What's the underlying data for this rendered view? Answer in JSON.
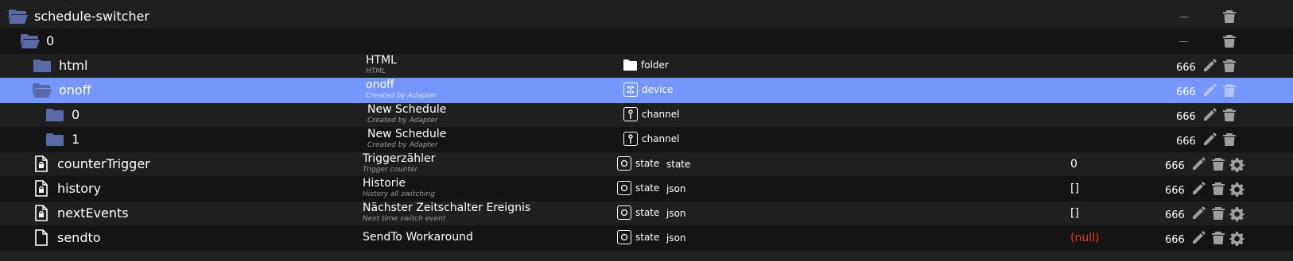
{
  "rows": [
    {
      "name": "schedule-switcher",
      "title": "",
      "desc": "",
      "type": "",
      "role": "",
      "value": "",
      "acl": "—"
    },
    {
      "name": "0",
      "title": "",
      "desc": "",
      "type": "",
      "role": "",
      "value": "",
      "acl": "—"
    },
    {
      "name": "html",
      "title": "HTML",
      "desc": "HTML",
      "type": "folder",
      "role": "",
      "value": "",
      "acl": "666"
    },
    {
      "name": "onoff",
      "title": "onoff",
      "desc": "Created by Adapter",
      "type": "device",
      "role": "",
      "value": "",
      "acl": "666"
    },
    {
      "name": "0",
      "title": "New Schedule",
      "desc": "Created by Adapter",
      "type": "channel",
      "role": "",
      "value": "",
      "acl": "666"
    },
    {
      "name": "1",
      "title": "New Schedule",
      "desc": "Created by Adapter",
      "type": "channel",
      "role": "",
      "value": "",
      "acl": "666"
    },
    {
      "name": "counterTrigger",
      "title": "Triggerzähler",
      "desc": "Trigger counter",
      "type": "state",
      "role": "state",
      "value": "0",
      "acl": "666"
    },
    {
      "name": "history",
      "title": "Historie",
      "desc": "History all switching",
      "type": "state",
      "role": "json",
      "value": "[]",
      "acl": "666"
    },
    {
      "name": "nextEvents",
      "title": "Nächster Zeitschalter Ereignis",
      "desc": "Next time switch event",
      "type": "state",
      "role": "json",
      "value": "[]",
      "acl": "666"
    },
    {
      "name": "sendto",
      "title": "SendTo Workaround",
      "desc": "",
      "type": "state",
      "role": "json",
      "value": "(null)",
      "acl": "666"
    }
  ],
  "colors": {
    "background": "#1f1f1f",
    "row_alt": "#141414",
    "selected": "#7597fd",
    "folder_icon": "#5a6aa8",
    "null_value": "#e23b2f",
    "action_icon": "#9e9e9e"
  },
  "icons": {
    "open_folder": "folder-open-icon",
    "closed_folder": "folder-icon",
    "state": "file-lock-icon",
    "file": "file-icon",
    "edit": "pencil-icon",
    "delete": "trash-icon",
    "settings": "gear-icon"
  }
}
